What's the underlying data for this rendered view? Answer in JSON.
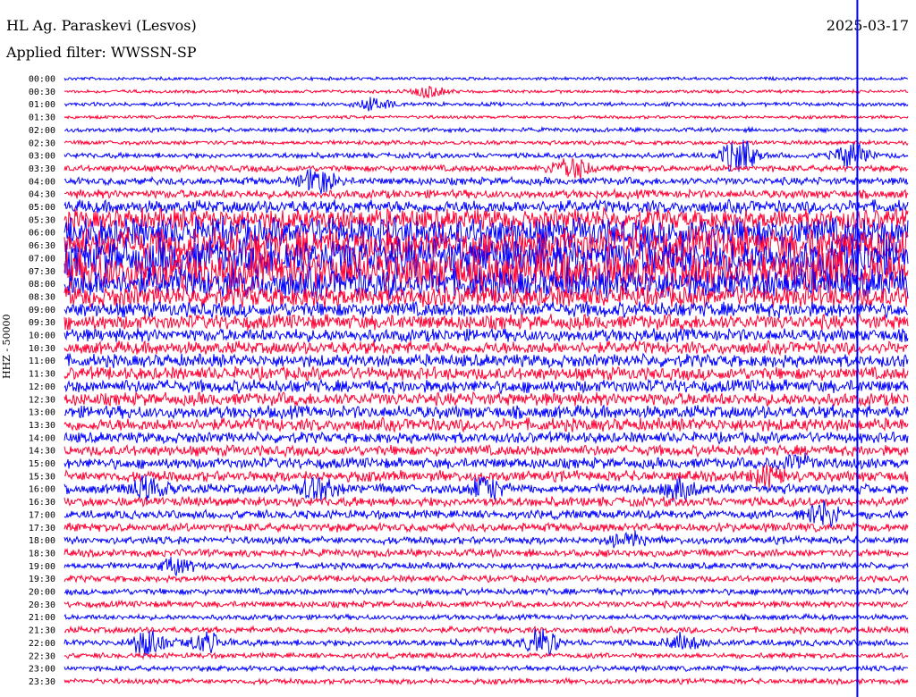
{
  "header": {
    "station": "HL Ag. Paraskevi (Lesvos)",
    "filter": "Applied filter: WWSSN-SP",
    "date": "2025-03-17"
  },
  "colors": {
    "blue": "#0000ff",
    "red": "#ff0033",
    "background": "#ffffff"
  },
  "chart_data": {
    "type": "line",
    "title": "HL Ag. Paraskevi (Lesvos)",
    "ylabel": "HHZ - 50000",
    "xlabel": "",
    "row_labels": [
      "00:00",
      "00:30",
      "01:00",
      "01:30",
      "02:00",
      "02:30",
      "03:00",
      "03:30",
      "04:00",
      "04:30",
      "05:00",
      "05:30",
      "06:00",
      "06:30",
      "07:00",
      "07:30",
      "08:00",
      "08:30",
      "09:00",
      "09:30",
      "10:00",
      "10:30",
      "11:00",
      "11:30",
      "12:00",
      "12:30",
      "13:00",
      "13:30",
      "14:00",
      "14:30",
      "15:00",
      "15:30",
      "16:00",
      "16:30",
      "17:00",
      "17:30",
      "18:00",
      "18:30",
      "19:00",
      "19:30",
      "20:00",
      "20:30",
      "21:00",
      "21:30",
      "22:00",
      "22:30",
      "23:00",
      "23:30"
    ],
    "row_colors": [
      "blue",
      "red"
    ],
    "noise_level": [
      1.5,
      1.5,
      1.8,
      1.5,
      2,
      2,
      2.5,
      3,
      3.5,
      4,
      6,
      10,
      14,
      16,
      18,
      18,
      14,
      10,
      7,
      7,
      6,
      6,
      6,
      6,
      6,
      6,
      6,
      6,
      5,
      5,
      5,
      5,
      4.5,
      4.5,
      4,
      4,
      3.5,
      3.5,
      3,
      3,
      3,
      3,
      2.5,
      3,
      3,
      2.5,
      2.5,
      2.5
    ],
    "events": [
      {
        "row": 1,
        "minute": 13,
        "amplitude": 7
      },
      {
        "row": 2,
        "minute": 11,
        "amplitude": 9
      },
      {
        "row": 6,
        "minute": 24,
        "amplitude": 22
      },
      {
        "row": 6,
        "minute": 28,
        "amplitude": 15
      },
      {
        "row": 7,
        "minute": 18,
        "amplitude": 18
      },
      {
        "row": 8,
        "minute": 9,
        "amplitude": 16
      },
      {
        "row": 15,
        "minute": 27,
        "amplitude": 14
      },
      {
        "row": 30,
        "minute": 26,
        "amplitude": 10
      },
      {
        "row": 31,
        "minute": 25,
        "amplitude": 12
      },
      {
        "row": 32,
        "minute": 3,
        "amplitude": 14
      },
      {
        "row": 32,
        "minute": 9,
        "amplitude": 14
      },
      {
        "row": 32,
        "minute": 15,
        "amplitude": 14
      },
      {
        "row": 32,
        "minute": 22,
        "amplitude": 14
      },
      {
        "row": 34,
        "minute": 27,
        "amplitude": 16
      },
      {
        "row": 36,
        "minute": 20,
        "amplitude": 10
      },
      {
        "row": 38,
        "minute": 4,
        "amplitude": 9
      },
      {
        "row": 44,
        "minute": 3,
        "amplitude": 17
      },
      {
        "row": 44,
        "minute": 5,
        "amplitude": 12
      },
      {
        "row": 44,
        "minute": 17,
        "amplitude": 15
      },
      {
        "row": 44,
        "minute": 22,
        "amplitude": 10
      }
    ],
    "vertical_marker": {
      "row_from": 0,
      "row_to": 47,
      "minute": 28.2,
      "color": "blue"
    }
  }
}
